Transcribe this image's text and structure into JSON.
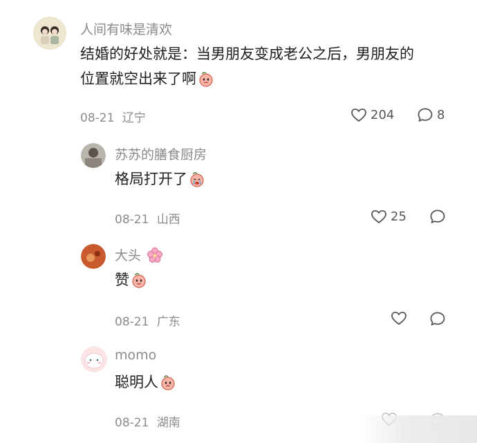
{
  "comments": [
    {
      "author": "人间有味是清欢",
      "text_line1": "结婚的好处就是：当男朋友变成老公之后，男朋友的",
      "text_line2": "位置就空出来了啊",
      "date": "08-21",
      "location": "辽宁",
      "likes": "204",
      "replies": "8"
    }
  ],
  "replies": [
    {
      "author": "苏苏的膳食厨房",
      "text": "格局打开了",
      "date": "08-21",
      "location": "山西",
      "likes": "25"
    },
    {
      "author": "大头",
      "text": "赞",
      "date": "08-21",
      "location": "广东"
    },
    {
      "author": "momo",
      "text": "聪明人",
      "date": "08-21",
      "location": "湖南"
    }
  ],
  "icons": [
    "heart-icon",
    "comment-bubble-icon",
    "peach-emoji-icon",
    "crying-emoji-icon",
    "cherry-blossom-icon"
  ]
}
